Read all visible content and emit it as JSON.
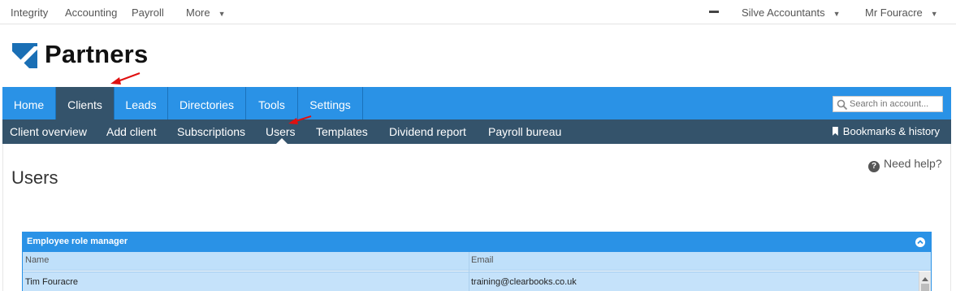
{
  "topbar": {
    "apps": [
      "Integrity",
      "Accounting",
      "Payroll"
    ],
    "more_label": "More",
    "account_label": "Silve Accountants",
    "user_label": "Mr Fouracre"
  },
  "logo": {
    "text": "Partners"
  },
  "mainnav": {
    "tabs": [
      "Home",
      "Clients",
      "Leads",
      "Directories",
      "Tools",
      "Settings"
    ],
    "active": "Clients",
    "search_placeholder": "Search in account..."
  },
  "subnav": {
    "items": [
      "Client overview",
      "Add client",
      "Subscriptions",
      "Users",
      "Templates",
      "Dividend report",
      "Payroll bureau"
    ],
    "active": "Users",
    "bookmarks_label": "Bookmarks & history"
  },
  "page": {
    "title": "Users",
    "help_label": "Need help?"
  },
  "panel": {
    "title": "Employee role manager",
    "columns": [
      "Name",
      "Email"
    ],
    "rows": [
      {
        "name": "Tim Fouracre",
        "email": "training@clearbooks.co.uk"
      }
    ]
  },
  "colors": {
    "nav_blue": "#2a92e6",
    "nav_dark": "#34536b",
    "annotation_red": "#e01010"
  }
}
